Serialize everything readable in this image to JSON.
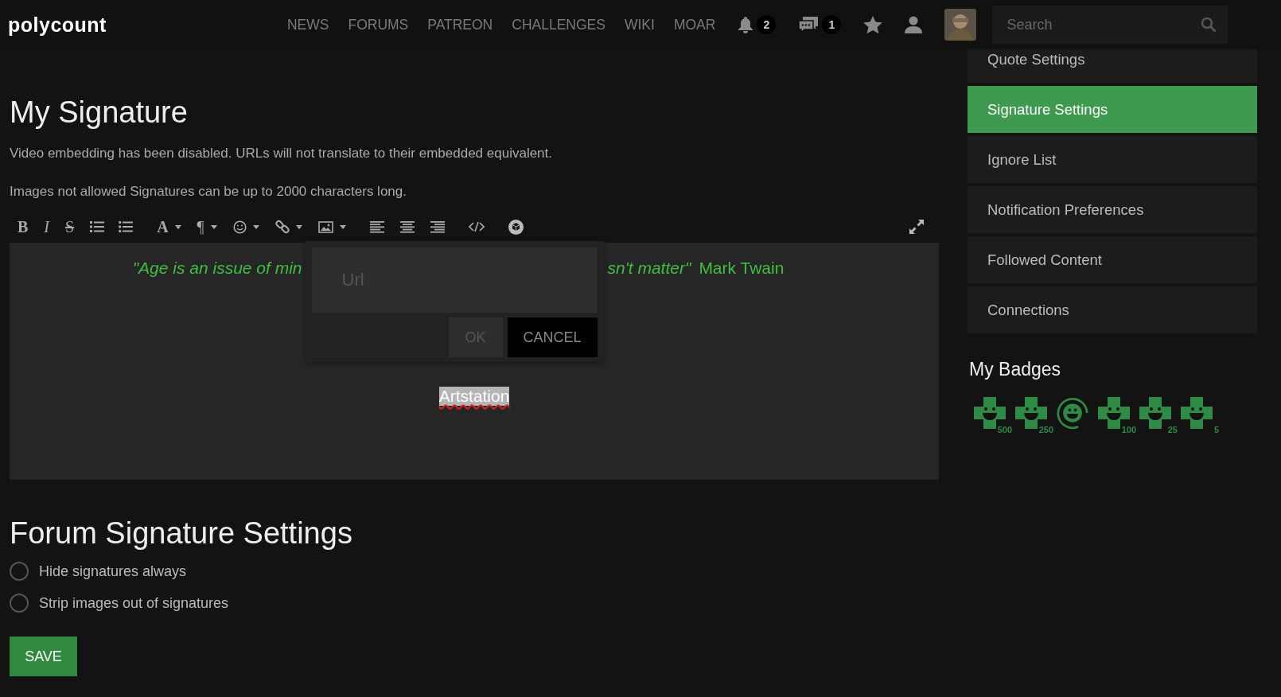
{
  "header": {
    "logo": "polycount",
    "nav": [
      "NEWS",
      "FORUMS",
      "PATREON",
      "CHALLENGES",
      "WIKI",
      "MOAR"
    ],
    "icons": [
      {
        "kind": "bell",
        "count": "2"
      },
      {
        "kind": "chat",
        "count": "1"
      },
      {
        "kind": "star"
      },
      {
        "kind": "user"
      },
      {
        "kind": "avatar"
      }
    ],
    "search": {
      "placeholder": "Search"
    }
  },
  "signature": {
    "title": "My Signature",
    "notes": [
      "Video embedding has been disabled. URLs will not translate to their embedded equivalent.",
      "Images not allowed Signatures can be up to 2000 characters long."
    ],
    "toolbar": [
      {
        "kind": "bold",
        "glyph": "B"
      },
      {
        "kind": "italic",
        "glyph": "I"
      },
      {
        "kind": "strike",
        "glyph": "S"
      },
      {
        "kind": "ordered-list"
      },
      {
        "kind": "bullet-list"
      },
      {
        "kind": "font",
        "glyph": "A",
        "dropdown": true
      },
      {
        "kind": "paragraph",
        "glyph": "¶",
        "dropdown": true
      },
      {
        "kind": "smiley",
        "dropdown": true
      },
      {
        "kind": "link",
        "dropdown": true
      },
      {
        "kind": "image",
        "dropdown": true
      },
      {
        "kind": "align-left"
      },
      {
        "kind": "align-center"
      },
      {
        "kind": "align-right"
      },
      {
        "kind": "code"
      },
      {
        "kind": "cube"
      }
    ],
    "editor": {
      "quote_left": "\"Age is an issue of min",
      "quote_right": "sn't matter\"",
      "author": "Mark Twain",
      "selected_text": "Artstation"
    },
    "link_dialog": {
      "placeholder": "Url",
      "ok": {
        "label": "OK",
        "disabled": true
      },
      "cancel": "CANCEL"
    }
  },
  "forum_settings": {
    "title": "Forum Signature Settings",
    "options": [
      {
        "label": "Hide signatures always",
        "checked": false
      },
      {
        "label": "Strip images out of signatures",
        "checked": false
      }
    ]
  },
  "save": "SAVE",
  "sidebar": {
    "items": [
      {
        "label": "Quote Settings",
        "selected": false
      },
      {
        "label": "Signature Settings",
        "selected": true
      },
      {
        "label": "Ignore List",
        "selected": false
      },
      {
        "label": "Notification Preferences",
        "selected": false
      },
      {
        "label": "Followed Content",
        "selected": false
      },
      {
        "label": "Connections",
        "selected": false
      }
    ],
    "badges_title": "My Badges",
    "badges": [
      {
        "kind": "cross",
        "count": "500"
      },
      {
        "kind": "cross",
        "count": "250"
      },
      {
        "kind": "ring"
      },
      {
        "kind": "cross",
        "count": "100"
      },
      {
        "kind": "cross",
        "count": "25"
      },
      {
        "kind": "cross",
        "count": "5"
      }
    ]
  }
}
